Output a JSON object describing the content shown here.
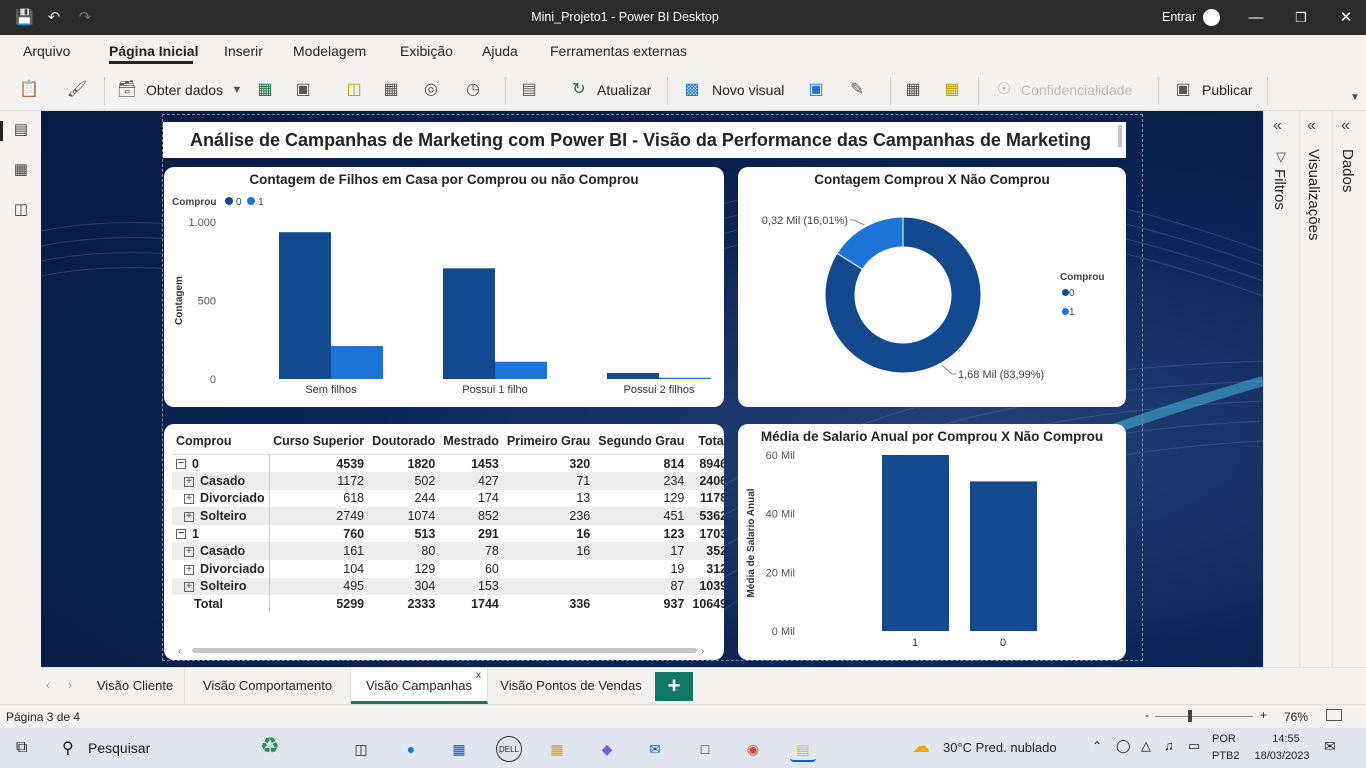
{
  "window": {
    "title": "Mini_Projeto1 - Power BI Desktop",
    "signin": "Entrar"
  },
  "menu": [
    "Arquivo",
    "Página Inicial",
    "Inserir",
    "Modelagem",
    "Exibição",
    "Ajuda",
    "Ferramentas externas"
  ],
  "ribbon": {
    "get_data": "Obter dados",
    "refresh": "Atualizar",
    "new_visual": "Novo visual",
    "confidentiality": "Confidencialidade",
    "publish": "Publicar"
  },
  "report": {
    "header": "Análise de Campanhas de Marketing com Power BI - Visão da Performance das Campanhas de Marketing"
  },
  "chart_data": [
    {
      "type": "bar",
      "title": "Contagem de Filhos em Casa por Comprou ou não Comprou",
      "legend_title": "Comprou",
      "ylabel": "Contagem",
      "categories": [
        "Sem filhos",
        "Possui 1 filho",
        "Possui 2 filhos"
      ],
      "series": [
        {
          "name": "0",
          "values": [
            935,
            705,
            38
          ]
        },
        {
          "name": "1",
          "values": [
            210,
            110,
            8
          ]
        }
      ],
      "yticks": [
        "1.000",
        "500",
        "0"
      ],
      "ylim": [
        0,
        1000
      ],
      "colors": [
        "#12498f",
        "#1b74d8"
      ]
    },
    {
      "type": "pie",
      "title": "Contagem Comprou X Não Comprou",
      "legend_title": "Comprou",
      "labels": [
        "0",
        "1"
      ],
      "values": [
        83.99,
        16.01
      ],
      "data_labels": [
        "1,68 Mil (83,99%)",
        "0,32 Mil (16,01%)"
      ],
      "colors": [
        "#12498f",
        "#1b74d8"
      ]
    },
    {
      "type": "bar",
      "title": "Média de Salario Anual por Comprou X Não Comprou",
      "ylabel": "Média de Salario Anual",
      "categories": [
        "1",
        "0"
      ],
      "values": [
        60000,
        51000
      ],
      "yticks": [
        "60 Mil",
        "40 Mil",
        "20 Mil",
        "0 Mil"
      ],
      "ylim": [
        0,
        60000
      ],
      "colors": [
        "#12498f"
      ]
    },
    {
      "type": "table",
      "columns": [
        "Comprou",
        "Curso Superior",
        "Doutorado",
        "Mestrado",
        "Primeiro Grau",
        "Segundo Grau",
        "Total"
      ],
      "rows": [
        {
          "kind": "grp",
          "cells": [
            "0",
            "4539",
            "1820",
            "1453",
            "320",
            "814",
            "8946"
          ]
        },
        {
          "kind": "sub",
          "cells": [
            "Casado",
            "1172",
            "502",
            "427",
            "71",
            "234",
            "2406"
          ]
        },
        {
          "kind": "sub",
          "cells": [
            "Divorciado",
            "618",
            "244",
            "174",
            "13",
            "129",
            "1178"
          ]
        },
        {
          "kind": "sub",
          "cells": [
            "Solteiro",
            "2749",
            "1074",
            "852",
            "236",
            "451",
            "5362"
          ]
        },
        {
          "kind": "grp",
          "cells": [
            "1",
            "760",
            "513",
            "291",
            "16",
            "123",
            "1703"
          ]
        },
        {
          "kind": "sub",
          "cells": [
            "Casado",
            "161",
            "80",
            "78",
            "16",
            "17",
            "352"
          ]
        },
        {
          "kind": "sub",
          "cells": [
            "Divorciado",
            "104",
            "129",
            "60",
            "",
            "19",
            "312"
          ]
        },
        {
          "kind": "sub",
          "cells": [
            "Solteiro",
            "495",
            "304",
            "153",
            "",
            "87",
            "1039"
          ]
        },
        {
          "kind": "tot",
          "cells": [
            "Total",
            "5299",
            "2333",
            "1744",
            "336",
            "937",
            "10649"
          ]
        }
      ]
    }
  ],
  "panes": {
    "filters": "Filtros",
    "visualizations": "Visualizações",
    "data": "Dados"
  },
  "tabs": [
    "Visão Cliente",
    "Visão Comportamento",
    "Visão Campanhas",
    "Visão Pontos de Vendas"
  ],
  "active_tab": "Visão Campanhas",
  "status": {
    "page": "Página 3 de 4",
    "zoom": "76%"
  },
  "taskbar": {
    "search": "Pesquisar",
    "weather": "30°C  Pred. nublado",
    "lang1": "POR",
    "lang2": "PTB2",
    "time": "14:55",
    "date": "18/03/2023"
  }
}
